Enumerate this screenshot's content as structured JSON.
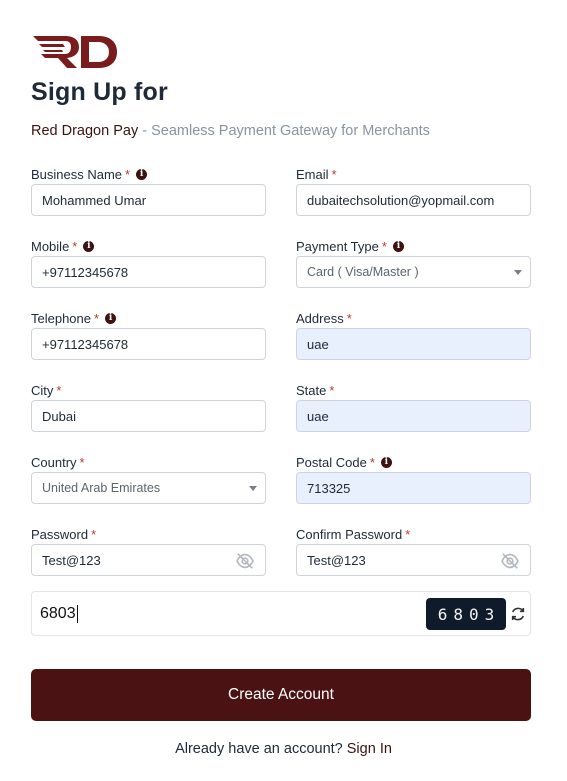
{
  "header": {
    "title": "Sign Up for",
    "brand": "Red Dragon Pay",
    "tagline": " - Seamless Payment Gateway for Merchants"
  },
  "form": {
    "business_name": {
      "label": "Business Name",
      "value": "Mohammed Umar"
    },
    "email": {
      "label": "Email",
      "value": "dubaitechsolution@yopmail.com"
    },
    "mobile": {
      "label": "Mobile",
      "value": "+97112345678"
    },
    "payment_type": {
      "label": "Payment Type",
      "value": "Card ( Visa/Master )"
    },
    "telephone": {
      "label": "Telephone",
      "value": "+97112345678"
    },
    "address": {
      "label": "Address",
      "value": "uae"
    },
    "city": {
      "label": "City",
      "value": "Dubai"
    },
    "state": {
      "label": "State",
      "value": "uae"
    },
    "country": {
      "label": "Country",
      "value": "United Arab Emirates"
    },
    "postal_code": {
      "label": "Postal Code",
      "value": "713325"
    },
    "password": {
      "label": "Password",
      "value": "Test@123"
    },
    "confirm_password": {
      "label": "Confirm Password",
      "value": "Test@123"
    },
    "required_mark": "*"
  },
  "captcha": {
    "entered": "6803",
    "code": "6803"
  },
  "actions": {
    "create_account": "Create Account",
    "already_text": "Already have an account? ",
    "sign_in": "Sign In"
  },
  "colors": {
    "brand": "#4a1212",
    "filled_input": "#e8f0fe",
    "captcha_bg": "#0f1a2b"
  },
  "icons": {
    "logo": "rd-logo",
    "info": "info-icon",
    "eye_off": "eye-off-icon",
    "refresh": "refresh-icon",
    "dropdown": "chevron-down-icon"
  }
}
